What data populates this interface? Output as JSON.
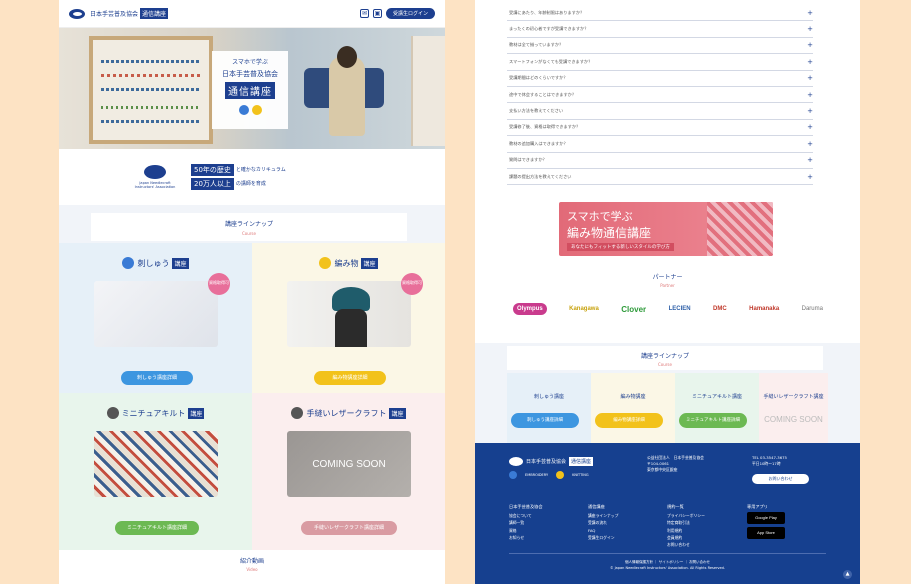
{
  "left": {
    "header": {
      "logo_text": "日本手芸普及協会",
      "logo_badge": "通信講座",
      "login_label": "受講生ログイン",
      "icon1": "mail-icon",
      "icon2": "cart-icon"
    },
    "hero": {
      "line1": "スマホで学ぶ",
      "line2": "日本手芸普及協会",
      "line3": "通信講座"
    },
    "history": {
      "logo_text": "Japan Needlecraft Instructors' Association",
      "item1_badge": "50年の歴史",
      "item1_text": "と確かなカリキュラム",
      "item2_badge": "20万人以上",
      "item2_text": "の講師を育成"
    },
    "lineup": {
      "title": "講座ラインナップ",
      "sub": "Course"
    },
    "courses": [
      {
        "name": "刺しゅう",
        "badge": "講座",
        "tag": "資格取得可",
        "button": "刺しゅう講座詳細"
      },
      {
        "name": "編み物",
        "badge": "講座",
        "tag": "資格取得可",
        "button": "編み物講座詳細"
      },
      {
        "name": "ミニチュアキルト",
        "badge": "講座",
        "button": "ミニチュアキルト講座詳細"
      },
      {
        "name": "手縫いレザークラフト",
        "badge": "講座",
        "coming": "COMING SOON",
        "button": "手縫いレザークラフト講座詳細"
      }
    ],
    "video_title": "紹介動画",
    "video_sub": "Video"
  },
  "right": {
    "faq": [
      "受講にあたり、年齢制限はありますか？",
      "まったくの初心者ですが受講できますか？",
      "教材は全て揃っていますか？",
      "スマートフォンがなくても受講できますか？",
      "受講期間はどのくらいですか？",
      "途中で休会することはできますか？",
      "支払い方法を教えてください",
      "受講修了後、資格は取得できますか？",
      "教材の追加購入はできますか？",
      "質問はできますか？",
      "課題の提出方法を教えてください"
    ],
    "banner": {
      "line1": "スマホで学ぶ",
      "line2": "編み物通信講座",
      "line3": "あなたにもフィットする新しいスタイルの学び方"
    },
    "partner_title": "パートナー",
    "partner_sub": "Partner",
    "partners": [
      "Olympus",
      "Kanagawa",
      "Clover",
      "LECIEN",
      "DMC",
      "Hamanaka",
      "Daruma"
    ],
    "lineup": {
      "title": "講座ラインナップ",
      "sub": "Course"
    },
    "mini_courses": [
      {
        "name": "刺しゅう講座",
        "button": "刺しゅう講座詳細"
      },
      {
        "name": "編み物講座",
        "button": "編み物講座詳細"
      },
      {
        "name": "ミニチュアキルト講座",
        "button": "ミニチュアキルト講座詳細"
      },
      {
        "name": "手縫いレザークラフト講座",
        "coming": "COMING SOON"
      }
    ],
    "footer": {
      "logo_text": "日本手芸普及協会",
      "logo_badge": "通信講座",
      "sub1": "EMBROIDERY",
      "sub2": "KNITTING",
      "addr1": "公益社団法人　日本手芸普及協会",
      "addr2": "〒104-0061",
      "addr3": "東京都中央区銀座",
      "tel1": "TEL 03-3547-3675",
      "tel2": "平日10時〜17時",
      "contact_btn": "お問い合わせ",
      "col1_title": "日本手芸普及協会",
      "col1": [
        "協会について",
        "講師一覧",
        "資格",
        "お知らせ"
      ],
      "col2_title": "通信講座",
      "col2": [
        "講座ラインナップ",
        "受講の流れ",
        "FAQ",
        "受講生ログイン"
      ],
      "col3_title": "規約一覧",
      "col3": [
        "プライバシーポリシー",
        "特定商取引法",
        "利用規約",
        "会員規約",
        "お問い合わせ"
      ],
      "col4_title": "専用アプリ",
      "store1": "Google Play",
      "store2": "App Store",
      "copy1": "個人情報保護方針 ｜ サイトポリシー ｜ お問い合わせ",
      "copy2": "© Japan Needlecraft Instructors' Association. All Rights Reserved."
    }
  },
  "colors": {
    "brand": "#1d3f8f",
    "footer": "#16408f",
    "blue_btn": "#3d96e0",
    "yellow_btn": "#f2c21b",
    "green_btn": "#6cb953",
    "pink_btn": "#d99ba2"
  }
}
